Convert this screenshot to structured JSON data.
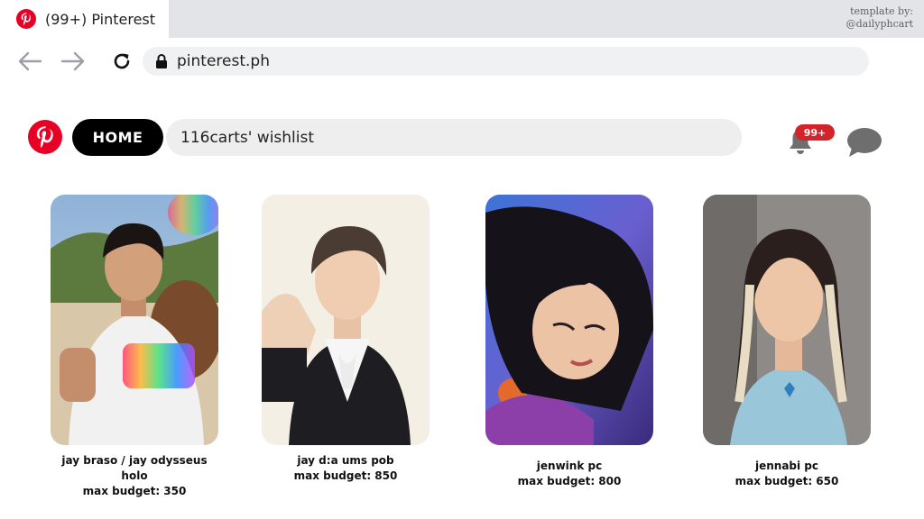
{
  "browser": {
    "tab_title": "(99+) Pinterest",
    "url": "pinterest.ph",
    "credit_line1": "template by:",
    "credit_line2": "@dailyphcart",
    "icons": [
      "back-arrow-icon",
      "forward-arrow-icon",
      "reload-icon",
      "lock-icon"
    ]
  },
  "header": {
    "home_label": "HOME",
    "search_value": "116carts' wishlist",
    "notification_count": "99+",
    "icons": [
      "pinterest-logo-icon",
      "bell-icon",
      "chat-icon"
    ],
    "colors": {
      "brand_red": "#e60023",
      "badge_red": "#d3242b",
      "home_bg": "#000000"
    }
  },
  "cards": [
    {
      "title": "jay braso / jay odysseus holo",
      "budget": "max budget: 350"
    },
    {
      "title": "jay d:a ums pob",
      "budget": "max budget: 850"
    },
    {
      "title": "jenwink pc",
      "budget": "max budget: 800"
    },
    {
      "title": "jennabi pc",
      "budget": "max budget: 650"
    }
  ]
}
